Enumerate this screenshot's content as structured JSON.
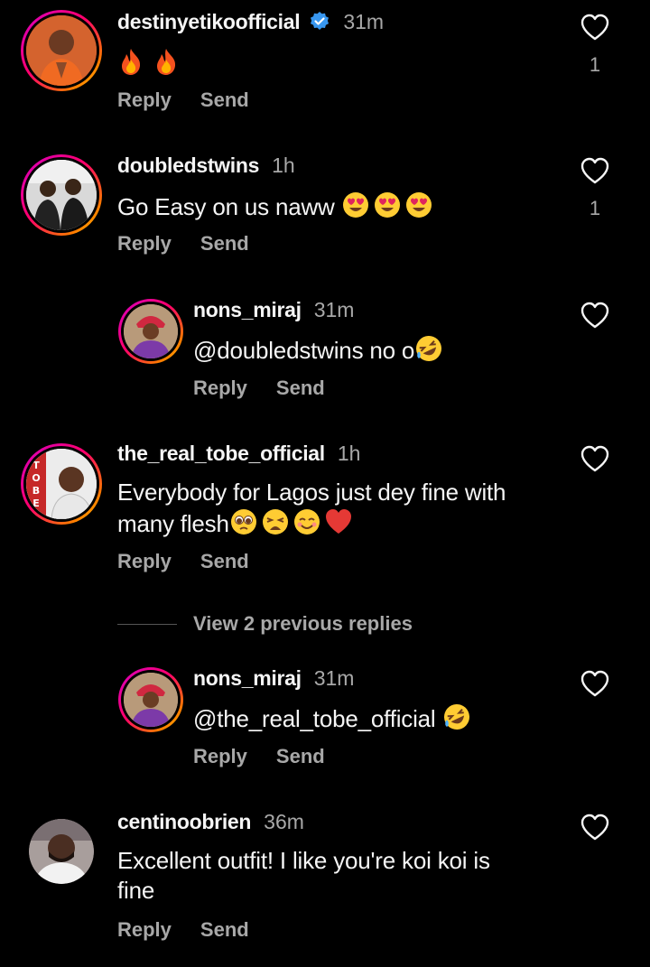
{
  "comments": [
    {
      "username": "destinyetikoofficial",
      "verified": true,
      "time": "31m",
      "text": "",
      "emojis": [
        "fire",
        "fire"
      ],
      "likes": "1",
      "reply_label": "Reply",
      "send_label": "Send"
    },
    {
      "username": "doubledstwins",
      "time": "1h",
      "text": "Go Easy on us naww ",
      "emojis": [
        "heart-eyes",
        "heart-eyes",
        "heart-eyes"
      ],
      "likes": "1",
      "reply_label": "Reply",
      "send_label": "Send"
    },
    {
      "username": "nons_miraj",
      "time": "31m",
      "text": "@doubledstwins no o",
      "emojis": [
        "rofl"
      ],
      "reply_label": "Reply",
      "send_label": "Send"
    },
    {
      "username": "the_real_tobe_official",
      "time": "1h",
      "text_line1": "Everybody for Lagos just dey fine with",
      "text_line2": "many flesh",
      "emojis": [
        "pleading",
        "weary",
        "smiling",
        "red-heart"
      ],
      "reply_label": "Reply",
      "send_label": "Send",
      "avatar_letters": [
        "T",
        "O",
        "B",
        "E"
      ]
    },
    {
      "username": "nons_miraj",
      "time": "31m",
      "text": "@the_real_tobe_official ",
      "emojis": [
        "rofl"
      ],
      "reply_label": "Reply",
      "send_label": "Send"
    },
    {
      "username": "centinoobrien",
      "time": "36m",
      "text_line1": "Excellent outfit! I like you're koi koi is",
      "text_line2": "fine",
      "reply_label": "Reply",
      "send_label": "Send"
    }
  ],
  "view_replies": "View 2 previous replies",
  "colors": {
    "background": "#000000",
    "primary_text": "#f5f5f5",
    "secondary_text": "#a8a8a8",
    "verified_blue": "#3897f0"
  }
}
